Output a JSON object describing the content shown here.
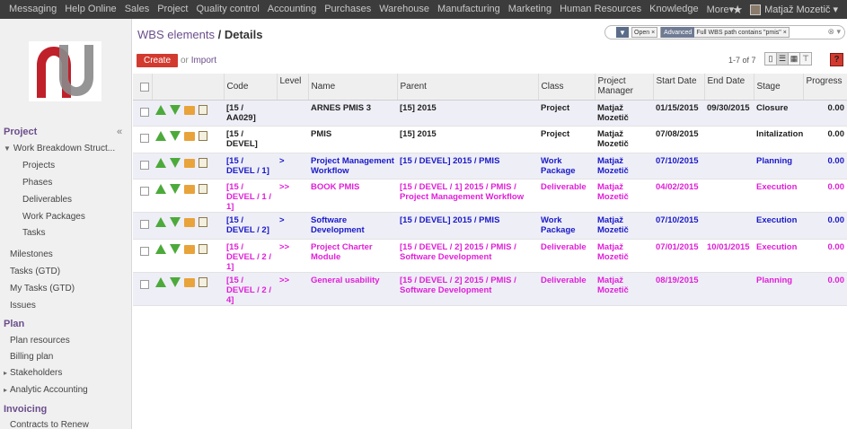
{
  "topbar": {
    "menu": [
      "Messaging",
      "Help Online",
      "Sales",
      "Project",
      "Quality control",
      "Accounting",
      "Purchases",
      "Warehouse",
      "Manufacturing",
      "Marketing",
      "Human Resources",
      "Knowledge",
      "More▾"
    ],
    "user": "Matjaž Mozetič ▾"
  },
  "sidebar": {
    "collapse": "«",
    "sections": [
      {
        "label": "Project"
      },
      {
        "label": "Plan"
      },
      {
        "label": "Invoicing"
      }
    ],
    "items": [
      "Work Breakdown Struct...",
      "Projects",
      "Phases",
      "Deliverables",
      "Work Packages",
      "Tasks",
      "Milestones",
      "Tasks (GTD)",
      "My Tasks (GTD)",
      "Issues",
      "Plan resources",
      "Billing plan",
      "Stakeholders",
      "Analytic Accounting",
      "Contracts to Renew"
    ]
  },
  "header": {
    "breadcrumb": "WBS elements",
    "sep": "/",
    "current": "Details"
  },
  "search": {
    "facet1": "Open",
    "facet2_label": "Advanced",
    "facet2_value": "Full WBS path contains \"pmis\"",
    "controls": "⊗ ▾"
  },
  "toolbar": {
    "create": "Create",
    "or": "or",
    "import": "Import",
    "pager": "1-7 of 7"
  },
  "colors": {
    "black": "#222222",
    "blue": "#1919c8",
    "magenta": "#e01fd8",
    "accent": "#d33a2f"
  },
  "table": {
    "headers": [
      "Code",
      "Level",
      "Name",
      "Parent",
      "Class",
      "Project Manager",
      "Start Date",
      "End Date",
      "Stage",
      "Progress"
    ],
    "rows": [
      {
        "color": "black",
        "code": "[15 / AA029]",
        "level": "",
        "name": "ARNES PMIS 3",
        "parent": "[15] 2015",
        "cls": "Project",
        "pm": "Matjaž Mozetič",
        "start": "01/15/2015",
        "end": "09/30/2015",
        "stage": "Closure",
        "progress": "0.00"
      },
      {
        "color": "black",
        "code": "[15 / DEVEL]",
        "level": "",
        "name": "PMIS",
        "parent": "[15] 2015",
        "cls": "Project",
        "pm": "Matjaž Mozetič",
        "start": "07/08/2015",
        "end": "",
        "stage": "Initalization",
        "progress": "0.00"
      },
      {
        "color": "blue",
        "code": "[15 / DEVEL / 1]",
        "level": ">",
        "name": "Project Management Workflow",
        "parent": "[15 / DEVEL] 2015 / PMIS",
        "cls": "Work Package",
        "pm": "Matjaž Mozetič",
        "start": "07/10/2015",
        "end": "",
        "stage": "Planning",
        "progress": "0.00"
      },
      {
        "color": "magenta",
        "code": "[15 / DEVEL / 1 / 1]",
        "level": ">>",
        "name": "BOOK PMIS",
        "parent": "[15 / DEVEL / 1] 2015 / PMIS / Project Management Workflow",
        "cls": "Deliverable",
        "pm": "Matjaž Mozetič",
        "start": "04/02/2015",
        "end": "",
        "stage": "Execution",
        "progress": "0.00"
      },
      {
        "color": "blue",
        "code": "[15 / DEVEL / 2]",
        "level": ">",
        "name": "Software Development",
        "parent": "[15 / DEVEL] 2015 / PMIS",
        "cls": "Work Package",
        "pm": "Matjaž Mozetič",
        "start": "07/10/2015",
        "end": "",
        "stage": "Execution",
        "progress": "0.00"
      },
      {
        "color": "magenta",
        "code": "[15 / DEVEL / 2 / 1]",
        "level": ">>",
        "name": "Project Charter Module",
        "parent": "[15 / DEVEL / 2] 2015 / PMIS / Software Development",
        "cls": "Deliverable",
        "pm": "Matjaž Mozetič",
        "start": "07/01/2015",
        "end": "10/01/2015",
        "stage": "Execution",
        "progress": "0.00"
      },
      {
        "color": "magenta",
        "code": "[15 / DEVEL / 2 / 4]",
        "level": ">>",
        "name": "General usability",
        "parent": "[15 / DEVEL / 2] 2015 / PMIS / Software Development",
        "cls": "Deliverable",
        "pm": "Matjaž Mozetič",
        "start": "08/19/2015",
        "end": "",
        "stage": "Planning",
        "progress": "0.00"
      }
    ]
  }
}
